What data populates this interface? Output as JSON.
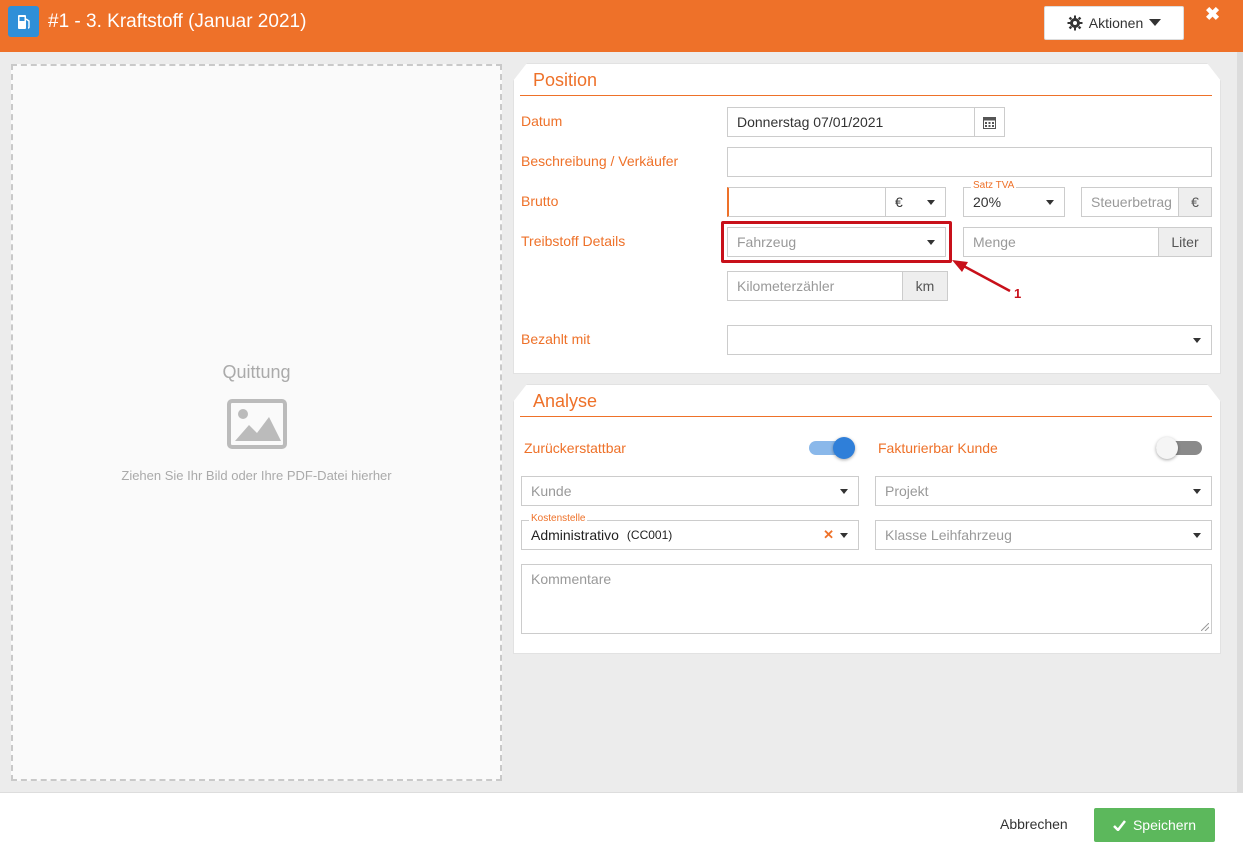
{
  "header": {
    "title": "#1 -  3. Kraftstoff (Januar 2021)",
    "actions_label": "Aktionen",
    "close_label": "✖",
    "app_icon": "fuel-pump-icon",
    "accent_color": "#ee7129"
  },
  "dropzone": {
    "title": "Quittung",
    "hint": "Ziehen Sie Ihr Bild oder Ihre PDF-Datei hierher",
    "icon": "image-icon"
  },
  "position": {
    "title": "Position",
    "date_label": "Datum",
    "date_value": "Donnerstag 07/01/2021",
    "description_label": "Beschreibung / Verkäufer",
    "description_value": "",
    "gross_label": "Brutto",
    "currency_value": "€",
    "vat_float_label": "Satz TVA",
    "vat_value": "20%",
    "tax_placeholder": "Steuerbetrag",
    "tax_currency": "€",
    "fuel_label": "Treibstoff Details",
    "vehicle_placeholder": "Fahrzeug",
    "quantity_placeholder": "Menge",
    "quantity_unit": "Liter",
    "odometer_placeholder": "Kilometerzähler",
    "odometer_unit": "km",
    "paid_with_label": "Bezahlt mit",
    "annotation_number": "1"
  },
  "analysis": {
    "title": "Analyse",
    "refundable_label": "Zurückerstattbar",
    "refundable_on": true,
    "billable_label": "Fakturierbar Kunde",
    "billable_on": false,
    "customer_placeholder": "Kunde",
    "project_placeholder": "Projekt",
    "cost_center_label": "Kostenstelle",
    "cost_center_value": "Administrativo",
    "cost_center_code": "(CC001)",
    "rental_class_placeholder": "Klasse Leihfahrzeug",
    "comments_placeholder": "Kommentare"
  },
  "footer": {
    "cancel_label": "Abbrechen",
    "save_label": "Speichern",
    "save_color": "#5cb85c"
  }
}
